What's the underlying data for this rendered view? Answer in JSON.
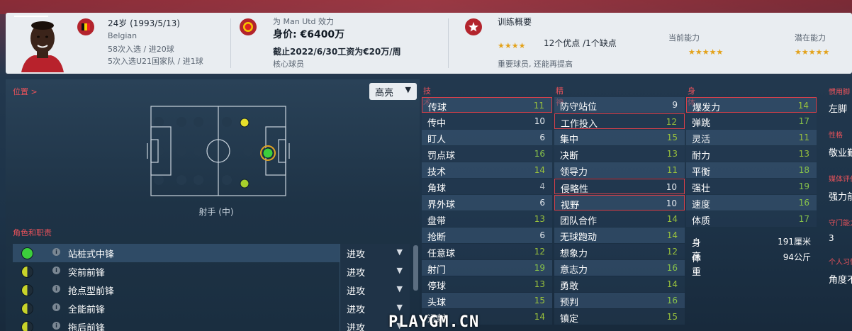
{
  "header": {
    "age_birth": "24岁 (1993/5/13)",
    "nationality": "Belgian",
    "caps_senior": "58次入选 / 进20球",
    "caps_u21": "5次入选U21国家队 / 进1球",
    "club_prefix": "为 Man Utd 效力",
    "value": "身价: €6400万",
    "contract": "截止2022/6/30工资为€20万/周",
    "squad_status": "核心球员",
    "training_title": "训练概要",
    "strengths": "12个优点 /1个缺点",
    "training_note": "重要球员, 还能再提高",
    "training_stars": "★★★★",
    "current_ability_label": "当前能力",
    "potential_ability_label": "潜在能力",
    "current_stars": "★★★★",
    "current_stars_empty": "★",
    "potential_stars": "★★★★",
    "potential_stars_empty": "★"
  },
  "left": {
    "position_label": "位置 >",
    "view_dropdown": "高亮",
    "pitch_caption": "射手 (中)",
    "roles_label": "角色和职责",
    "roles": [
      {
        "name": "站桩式中锋",
        "duty": "进攻"
      },
      {
        "name": "突前前锋",
        "duty": "进攻"
      },
      {
        "name": "抢点型前锋",
        "duty": "进攻"
      },
      {
        "name": "全能前锋",
        "duty": "进攻"
      },
      {
        "name": "拖后前锋",
        "duty": "进攻"
      }
    ]
  },
  "attributes": {
    "technical_label": "技术",
    "mental_label": "精神",
    "physical_label": "身体",
    "technical": [
      {
        "name": "传球",
        "value": "11"
      },
      {
        "name": "传中",
        "value": "10"
      },
      {
        "name": "盯人",
        "value": "6"
      },
      {
        "name": "罚点球",
        "value": "16"
      },
      {
        "name": "技术",
        "value": "14"
      },
      {
        "name": "角球",
        "value": "4"
      },
      {
        "name": "界外球",
        "value": "6"
      },
      {
        "name": "盘带",
        "value": "13"
      },
      {
        "name": "抢断",
        "value": "6"
      },
      {
        "name": "任意球",
        "value": "12"
      },
      {
        "name": "射门",
        "value": "19"
      },
      {
        "name": "停球",
        "value": "13"
      },
      {
        "name": "头球",
        "value": "15"
      },
      {
        "name": "远射",
        "value": "14"
      }
    ],
    "mental": [
      {
        "name": "防守站位",
        "value": "9"
      },
      {
        "name": "工作投入",
        "value": "12"
      },
      {
        "name": "集中",
        "value": "15"
      },
      {
        "name": "决断",
        "value": "13"
      },
      {
        "name": "领导力",
        "value": "11"
      },
      {
        "name": "侵略性",
        "value": "10"
      },
      {
        "name": "视野",
        "value": "10"
      },
      {
        "name": "团队合作",
        "value": "14"
      },
      {
        "name": "无球跑动",
        "value": "14"
      },
      {
        "name": "想象力",
        "value": "12"
      },
      {
        "name": "意志力",
        "value": "16"
      },
      {
        "name": "勇敢",
        "value": "14"
      },
      {
        "name": "预判",
        "value": "16"
      },
      {
        "name": "镇定",
        "value": "15"
      }
    ],
    "physical": [
      {
        "name": "爆发力",
        "value": "14"
      },
      {
        "name": "弹跳",
        "value": "17"
      },
      {
        "name": "灵活",
        "value": "11"
      },
      {
        "name": "耐力",
        "value": "13"
      },
      {
        "name": "平衡",
        "value": "18"
      },
      {
        "name": "强壮",
        "value": "19"
      },
      {
        "name": "速度",
        "value": "16"
      },
      {
        "name": "体质",
        "value": "17"
      }
    ],
    "height_label": "身高",
    "height_value": "191厘米",
    "weight_label": "体重",
    "weight_value": "94公斤"
  },
  "side": {
    "foot_label": "惯用脚",
    "foot_value": "左脚",
    "personality_label": "性格",
    "personality_value": "敬业勤",
    "media_label": "媒体评价",
    "media_value": "强力前",
    "gk_label": "守门能力",
    "gk_value": "3",
    "habits_label": "个人习惯",
    "habits_value": "角度不"
  },
  "watermark": "PLAYGM.CN"
}
